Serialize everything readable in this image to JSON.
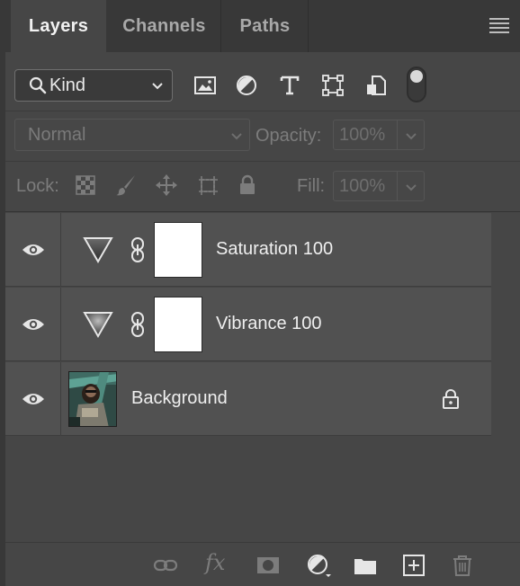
{
  "tabs": [
    {
      "label": "Layers",
      "active": true
    },
    {
      "label": "Channels",
      "active": false
    },
    {
      "label": "Paths",
      "active": false
    }
  ],
  "filter": {
    "kind_label": "Kind",
    "icons": [
      "pixel-filter-icon",
      "adjustment-filter-icon",
      "type-filter-icon",
      "shape-filter-icon",
      "smart-object-filter-icon"
    ]
  },
  "blend": {
    "mode": "Normal",
    "opacity_label": "Opacity:",
    "opacity_value": "100%"
  },
  "lock": {
    "label": "Lock:",
    "fill_label": "Fill:",
    "fill_value": "100%"
  },
  "layers": [
    {
      "name": "Saturation 100",
      "type": "adjustment",
      "visible": true
    },
    {
      "name": "Vibrance 100",
      "type": "adjustment",
      "visible": true
    },
    {
      "name": "Background",
      "type": "pixel",
      "visible": true,
      "locked": true
    }
  ],
  "colors": {
    "panel_bg": "#464646",
    "tabbar_bg": "#383838",
    "row_bg": "#515151",
    "text": "#efefef",
    "dim_text": "#7c7c7c"
  }
}
